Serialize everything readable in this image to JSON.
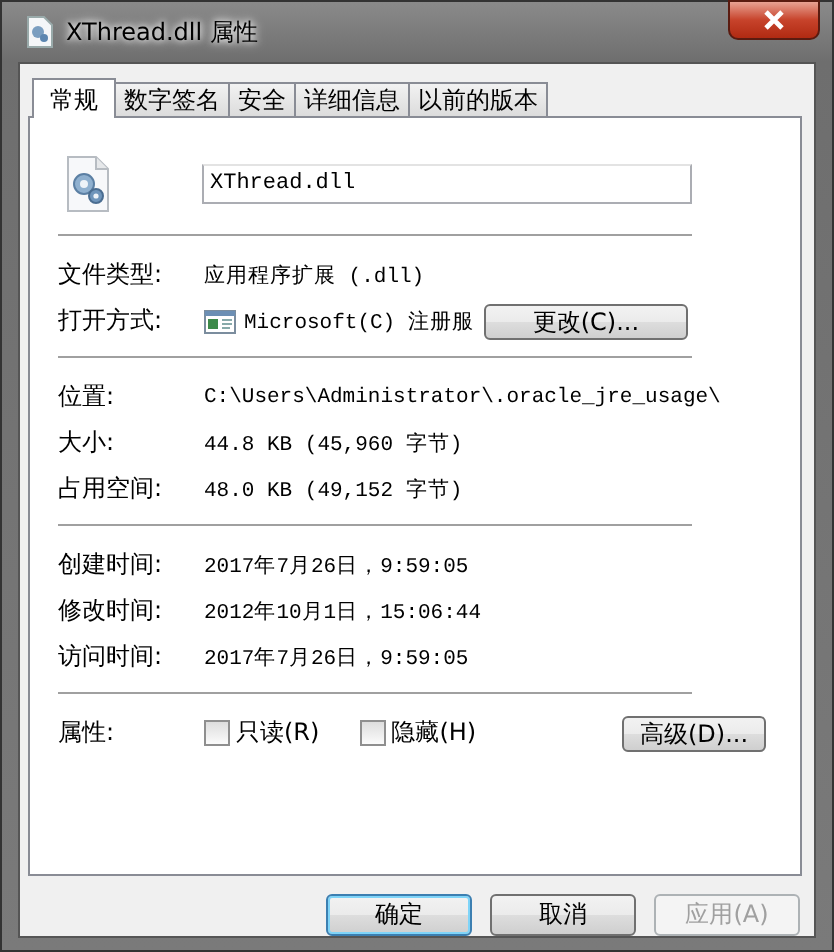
{
  "window": {
    "title": "XThread.dll 属性"
  },
  "tabs": [
    {
      "label": "常规",
      "selected": true
    },
    {
      "label": "数字签名",
      "selected": false
    },
    {
      "label": "安全",
      "selected": false
    },
    {
      "label": "详细信息",
      "selected": false
    },
    {
      "label": "以前的版本",
      "selected": false
    }
  ],
  "file_name": {
    "value": "XThread.dll"
  },
  "sections": [
    [
      {
        "kind": "text",
        "label": "文件类型:",
        "value": "应用程序扩展 (.dll)"
      },
      {
        "kind": "opens_with",
        "label": "打开方式:",
        "value": "Microsoft(C) 注册服",
        "button": "更改(C)..."
      }
    ],
    [
      {
        "kind": "text",
        "label": "位置:",
        "value": "C:\\Users\\Administrator\\.oracle_jre_usage\\"
      },
      {
        "kind": "text",
        "label": "大小:",
        "value": "44.8 KB (45,960 字节)"
      },
      {
        "kind": "text",
        "label": "占用空间:",
        "value": "48.0 KB (49,152 字节)"
      }
    ],
    [
      {
        "kind": "text",
        "label": "创建时间:",
        "value": "2017年7月26日，9:59:05"
      },
      {
        "kind": "text",
        "label": "修改时间:",
        "value": "2012年10月1日，15:06:44"
      },
      {
        "kind": "text",
        "label": "访问时间:",
        "value": "2017年7月26日，9:59:05"
      }
    ],
    [
      {
        "kind": "attributes",
        "label": "属性:",
        "checkboxes": [
          {
            "label": "只读(R)",
            "checked": false
          },
          {
            "label": "隐藏(H)",
            "checked": false
          }
        ],
        "button": "高级(D)..."
      }
    ]
  ],
  "buttons": [
    {
      "label": "确定",
      "default": true,
      "disabled": false
    },
    {
      "label": "取消",
      "default": false,
      "disabled": false
    },
    {
      "label": "应用(A)",
      "default": false,
      "disabled": true
    }
  ]
}
